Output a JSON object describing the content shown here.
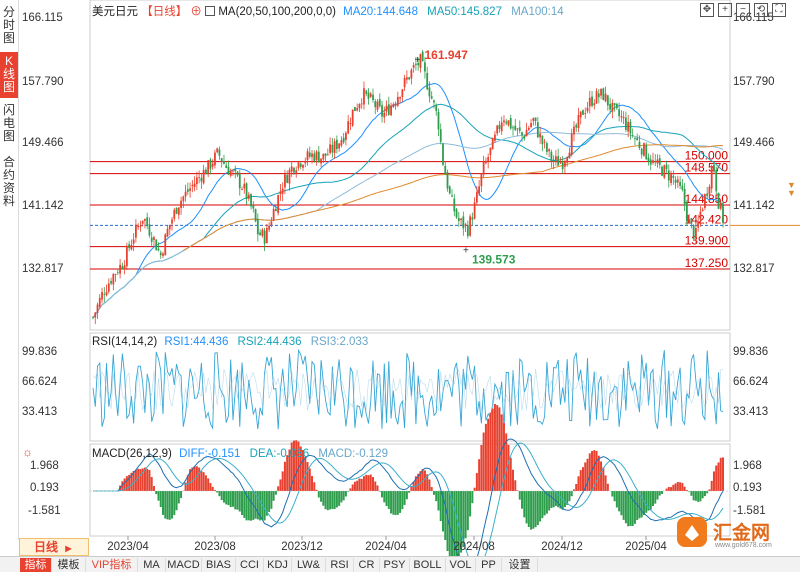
{
  "side_tabs": [
    {
      "label": "分时图",
      "active": false
    },
    {
      "label": "K线图",
      "active": true
    },
    {
      "label": "闪电图",
      "active": false
    },
    {
      "label": "合约资料",
      "active": false
    }
  ],
  "main": {
    "symbol": "美元日元",
    "period_tag": "【日线】",
    "ma_label": "MA(20,50,100,200,0,0)",
    "ma20": "MA20:144.648",
    "ma50": "MA50:145.827",
    "ma100": "MA100:14",
    "y_ticks": [
      "166.115",
      "157.790",
      "149.466",
      "141.142",
      "132.817"
    ],
    "high_label": "161.947",
    "low_label": "139.573",
    "levels": [
      "150.000",
      "148.570",
      "144.850",
      "142.420",
      "139.900",
      "137.250"
    ],
    "colors": {
      "ma20": "#1e90ff",
      "ma50": "#17a2b8",
      "ma100": "#8fbbd9",
      "ma200": "#e08a2e",
      "up": "#e8412f",
      "down": "#2e9e4d",
      "level_line": "#d40000",
      "current": "#2a6ec9"
    }
  },
  "rsi": {
    "title": "RSI(14,14,2)",
    "rsi1": "RSI1:44.436",
    "rsi2": "RSI2:44.436",
    "rsi3": "RSI3:2.033",
    "y_ticks": [
      "99.836",
      "66.624",
      "33.413"
    ]
  },
  "macd": {
    "title": "MACD(26,12,9)",
    "diff": "DIFF:-0.151",
    "dea": "DEA:-0.086",
    "macd": "MACD:-0.129",
    "y_ticks": [
      "1.968",
      "0.193",
      "-1.581"
    ]
  },
  "x_axis": {
    "labels": [
      "2023/04",
      "2023/08",
      "2023/12",
      "2024/04",
      "2024/08",
      "2024/12",
      "2025/04"
    ]
  },
  "period_selector": {
    "label": "日线",
    "arrow": "▶"
  },
  "bottom_tabs": [
    "指标",
    "模板",
    "VIP指标",
    "MA",
    "MACD",
    "BIAS",
    "CCI",
    "KDJ",
    "LW&",
    "RSI",
    "CR",
    "PSY",
    "BOLL",
    "VOL",
    "PP",
    "设置"
  ],
  "toolbar_icons": [
    "expand-icon",
    "zoom-in-icon",
    "zoom-out-icon",
    "restore-icon",
    "fullscreen-icon"
  ],
  "brand": {
    "name": "汇金网",
    "url": "www.gold678.com"
  },
  "chart_data": {
    "type": "candlestick",
    "x_range": [
      "2023/02",
      "2025/04"
    ],
    "ylim": [
      130.0,
      168.0
    ],
    "high": 161.947,
    "low": 139.573,
    "close_approx": 143.2,
    "levels": [
      150.0,
      148.57,
      144.85,
      142.42,
      139.9,
      137.25
    ],
    "path_points": [
      [
        0,
        131.5
      ],
      [
        4,
        134.5
      ],
      [
        8,
        136.5
      ],
      [
        12,
        138
      ],
      [
        16,
        141
      ],
      [
        20,
        143.5
      ],
      [
        24,
        141
      ],
      [
        27,
        138.8
      ],
      [
        30,
        142
      ],
      [
        34,
        145
      ],
      [
        38,
        146.5
      ],
      [
        42,
        148
      ],
      [
        46,
        149.3
      ],
      [
        50,
        151
      ],
      [
        53,
        149.5
      ],
      [
        56,
        148.5
      ],
      [
        60,
        147
      ],
      [
        64,
        144
      ],
      [
        66,
        141.5
      ],
      [
        69,
        141
      ],
      [
        72,
        144
      ],
      [
        76,
        147.5
      ],
      [
        80,
        149.5
      ],
      [
        84,
        150.3
      ],
      [
        88,
        150.8
      ],
      [
        92,
        150.5
      ],
      [
        96,
        151.5
      ],
      [
        100,
        153
      ],
      [
        104,
        156
      ],
      [
        108,
        158
      ],
      [
        112,
        157
      ],
      [
        116,
        155.5
      ],
      [
        120,
        157
      ],
      [
        124,
        159
      ],
      [
        128,
        161
      ],
      [
        131,
        161.9
      ],
      [
        134,
        159
      ],
      [
        138,
        155
      ],
      [
        140,
        150
      ],
      [
        143,
        145.5
      ],
      [
        146,
        143
      ],
      [
        150,
        142
      ],
      [
        153,
        145
      ],
      [
        156,
        149
      ],
      [
        160,
        152
      ],
      [
        164,
        155.5
      ],
      [
        168,
        154
      ],
      [
        172,
        153
      ],
      [
        176,
        155
      ],
      [
        180,
        152
      ],
      [
        184,
        150
      ],
      [
        188,
        150
      ],
      [
        192,
        153
      ],
      [
        196,
        156
      ],
      [
        200,
        157.5
      ],
      [
        204,
        158
      ],
      [
        208,
        156
      ],
      [
        212,
        155
      ],
      [
        216,
        153
      ],
      [
        220,
        151.5
      ],
      [
        224,
        149.8
      ],
      [
        228,
        149
      ],
      [
        232,
        148
      ],
      [
        236,
        146
      ],
      [
        238,
        143
      ],
      [
        241,
        141
      ],
      [
        243,
        144
      ],
      [
        246,
        147
      ],
      [
        248,
        150
      ],
      [
        250,
        145.5
      ],
      [
        252,
        143.2
      ]
    ],
    "rsi": {
      "values_approx_range": [
        10,
        95
      ],
      "last": 44.436
    },
    "macd": {
      "diff_last": -0.151,
      "dea_last": -0.086,
      "macd_last": -0.129
    }
  }
}
